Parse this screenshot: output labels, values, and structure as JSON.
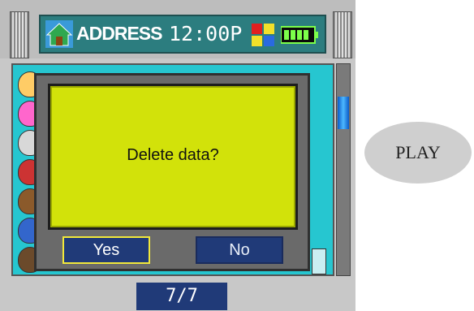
{
  "status_bar": {
    "app_title": "ADDRESS",
    "clock": "12:00P",
    "home_icon": "home-icon",
    "apps_icon": "apps-grid-icon",
    "battery_icon": "battery-icon"
  },
  "contacts": {
    "avatar_icon": "contact-avatar-icon",
    "avatar_count": 7
  },
  "dialog": {
    "message": "Delete data?",
    "yes_label": "Yes",
    "no_label": "No"
  },
  "pager": {
    "label": "7/7"
  },
  "play_button": {
    "label": "PLAY"
  },
  "colors": {
    "screen_bg": "#26c6d0",
    "dialog_panel": "#d2e20a",
    "button_bg": "#203a78",
    "status_bar": "#2c7d7f"
  }
}
